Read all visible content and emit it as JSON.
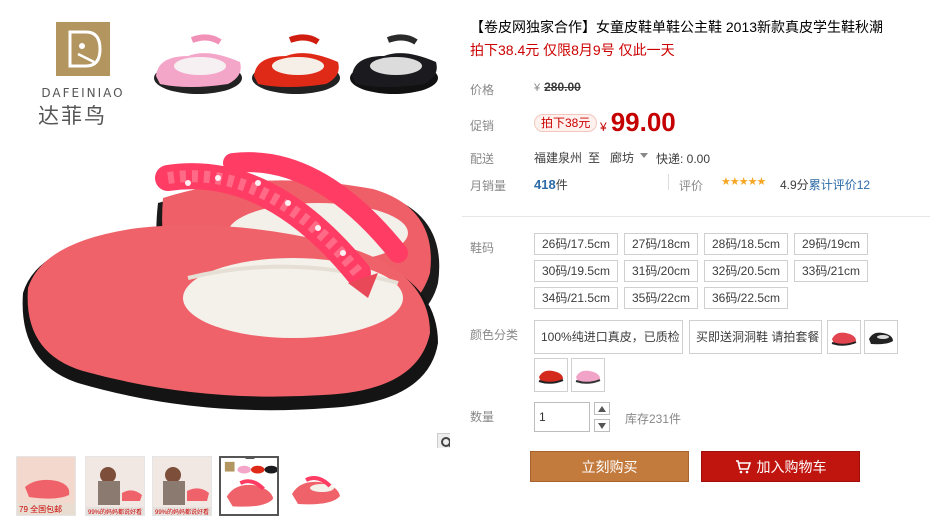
{
  "brand": {
    "name_en": "DAFEINIAO",
    "name_cn": "达菲鸟"
  },
  "product": {
    "title": "【卷皮网独家合作】女童皮鞋单鞋公主鞋 2013新款真皮学生鞋秋潮",
    "subtitle": "拍下38.4元 仅限8月9号 仅此一天"
  },
  "price": {
    "label": "价格",
    "currency_symbol": "¥",
    "original": "280.00"
  },
  "promo": {
    "label": "促销",
    "tag": "拍下38元",
    "currency_symbol": "¥",
    "price": "99.00"
  },
  "shipping": {
    "label": "配送",
    "from": "福建泉州",
    "to_word": "至",
    "destination": "廊坊",
    "express": "快递: 0.00"
  },
  "sales": {
    "label": "月销量",
    "count": "418",
    "unit": "件",
    "reviews_label": "评价",
    "stars": "★★★★★",
    "score": "4.9分",
    "review_link": "累计评价12"
  },
  "sizes": {
    "label": "鞋码",
    "options": [
      "26码/17.5cm",
      "27码/18cm",
      "28码/18.5cm",
      "29码/19cm",
      "30码/19.5cm",
      "31码/20cm",
      "32码/20.5cm",
      "33码/21cm",
      "34码/21.5cm",
      "35码/22cm",
      "36码/22.5cm"
    ]
  },
  "colors": {
    "label": "颜色分类",
    "text_options": [
      "100%纯进口真皮，已质检",
      "买即送洞洞鞋 请拍套餐"
    ],
    "swatches": [
      {
        "icon": "pink-red-shoe-swatch-icon",
        "color": "#e2454f"
      },
      {
        "icon": "black-shoe-swatch-icon",
        "color": "#222222"
      },
      {
        "icon": "red-shoe-swatch-icon",
        "color": "#d42a1e"
      },
      {
        "icon": "pink-shoe-swatch-icon",
        "color": "#f2a3c8"
      }
    ]
  },
  "quantity": {
    "label": "数量",
    "value": "1",
    "stock": "库存231件"
  },
  "actions": {
    "buy_now": "立刻购买",
    "add_to_cart": "加入购物车"
  },
  "thumbnails": {
    "captions": [
      "79 全国包邮",
      "99%的妈妈都说好看",
      "99%的妈妈都说好看"
    ],
    "count": 5,
    "active_index": 3
  },
  "colors_theme": {
    "shoe_main": "#f0626a",
    "price_red": "#c40000",
    "buy_button": "#c37a3d",
    "cart_button": "#c0150f",
    "link_blue": "#2d6ba8"
  }
}
